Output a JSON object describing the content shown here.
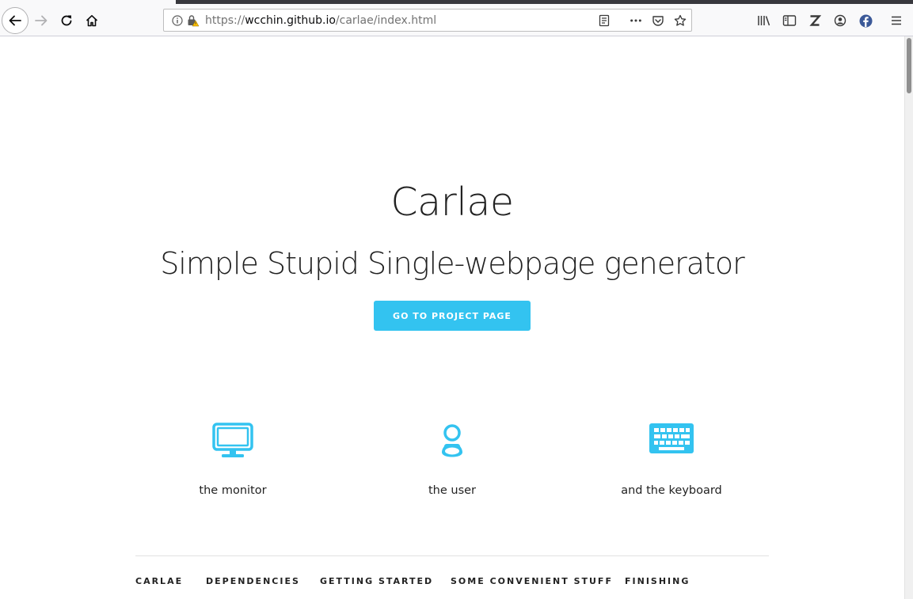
{
  "browser": {
    "url_scheme": "https://",
    "url_host": "wcchin.github.io",
    "url_path": "/carlae/index.html",
    "toolbar_icons": [
      "back-icon",
      "forward-icon",
      "reload-icon",
      "home-icon",
      "reader-view-icon",
      "page-actions-icon",
      "pocket-icon",
      "bookmark-star-icon",
      "library-icon",
      "sidebar-icon",
      "zotero-icon",
      "account-icon",
      "facebook-icon",
      "menu-icon"
    ]
  },
  "hero": {
    "title": "Carlae",
    "subtitle": "Simple Stupid Single-webpage generator",
    "cta_label": "GO TO PROJECT PAGE"
  },
  "features": [
    {
      "icon": "monitor-icon",
      "label": "the monitor"
    },
    {
      "icon": "user-icon",
      "label": "the user"
    },
    {
      "icon": "keyboard-icon",
      "label": "and the keyboard"
    }
  ],
  "nav": {
    "items": [
      {
        "label": "CARLAE"
      },
      {
        "label": "DEPENDENCIES"
      },
      {
        "label": "GETTING STARTED"
      },
      {
        "label": "SOME CONVENIENT STUFF"
      },
      {
        "label": "FINISHING"
      }
    ]
  },
  "colors": {
    "accent": "#33c3f0",
    "text": "#222222",
    "toolbar_bg": "#f9f9fa"
  }
}
